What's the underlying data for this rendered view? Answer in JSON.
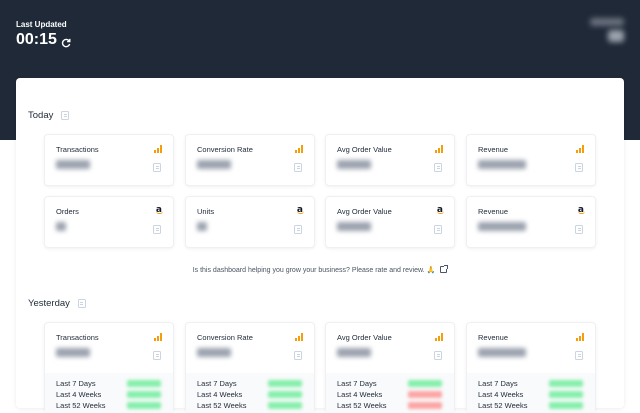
{
  "header": {
    "last_updated_label": "Last Updated",
    "last_updated_time": "00:15",
    "refresh_icon": "refresh-icon"
  },
  "colors": {
    "header_bg": "#1f2937",
    "bars_accent": "#f59e0b",
    "trend_up": "#86efac",
    "trend_down": "#fca5a5"
  },
  "today": {
    "title": "Today",
    "rows": [
      [
        {
          "label": "Transactions",
          "source": "bars-icon"
        },
        {
          "label": "Conversion Rate",
          "source": "bars-icon"
        },
        {
          "label": "Avg Order Value",
          "source": "bars-icon"
        },
        {
          "label": "Revenue",
          "source": "bars-icon"
        }
      ],
      [
        {
          "label": "Orders",
          "source": "amazon-icon"
        },
        {
          "label": "Units",
          "source": "amazon-icon"
        },
        {
          "label": "Avg Order Value",
          "source": "amazon-icon"
        },
        {
          "label": "Revenue",
          "source": "amazon-icon"
        }
      ]
    ]
  },
  "feedback": {
    "text": "Is this dashboard helping you grow your business? Please rate and review. 🙏"
  },
  "yesterday": {
    "title": "Yesterday",
    "cards": [
      {
        "label": "Transactions",
        "source": "bars-icon"
      },
      {
        "label": "Conversion Rate",
        "source": "bars-icon"
      },
      {
        "label": "Avg Order Value",
        "source": "bars-icon"
      },
      {
        "label": "Revenue",
        "source": "bars-icon"
      }
    ],
    "compare_labels": [
      "Last 7 Days",
      "Last 4 Weeks",
      "Last 52 Weeks"
    ],
    "compare_trends": [
      [
        "up",
        "up",
        "up"
      ],
      [
        "up",
        "up",
        "up"
      ],
      [
        "up",
        "down",
        "down"
      ],
      [
        "up",
        "up",
        "up"
      ]
    ]
  }
}
